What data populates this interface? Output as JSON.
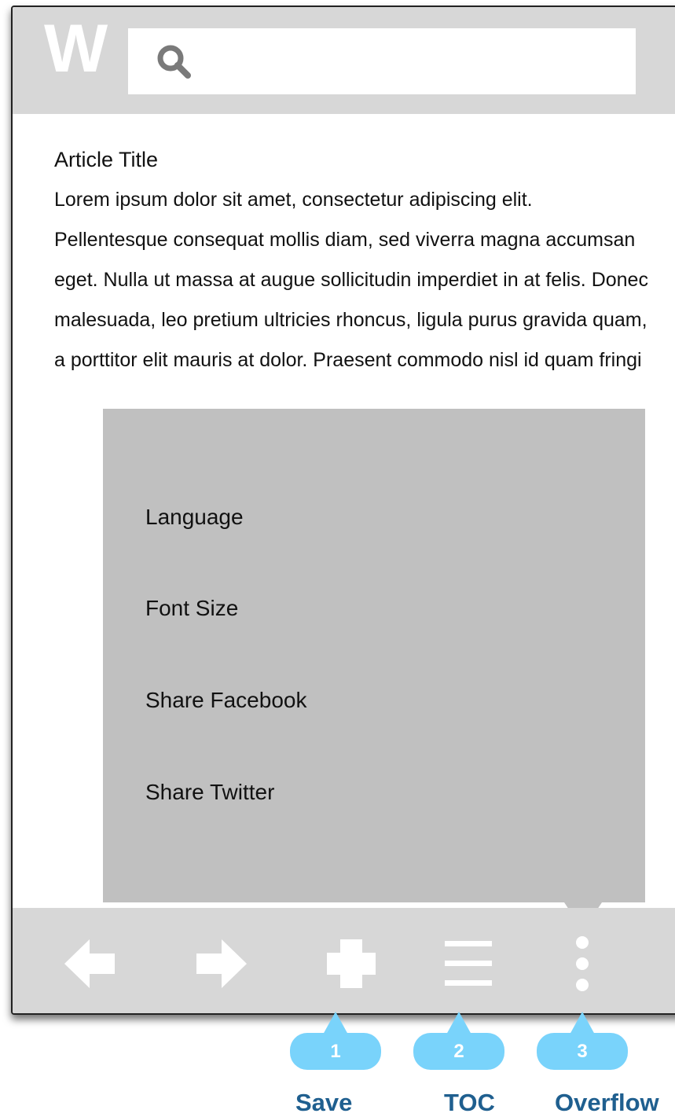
{
  "header": {
    "logo": "W"
  },
  "article": {
    "title": "Article Title",
    "body": "Lorem ipsum dolor sit amet, consectetur adipiscing elit. Pellentesque consequat mollis diam, sed viverra magna accumsan eget. Nulla ut massa at augue sollicitudin imperdiet in at felis. Donec malesuada, leo pretium ultricies rhoncus, ligula purus gravida quam, a porttitor elit mauris at dolor. Praesent commodo nisl id quam fringi"
  },
  "overflow_menu": {
    "items": [
      {
        "label": "Language"
      },
      {
        "label": "Font Size"
      },
      {
        "label": "Share Facebook"
      },
      {
        "label": "Share Twitter"
      }
    ]
  },
  "bottom_nav": {
    "icons": [
      "back-arrow-icon",
      "forward-arrow-icon",
      "plus-icon",
      "menu-lines-icon",
      "more-vertical-icon"
    ]
  },
  "callouts": [
    {
      "number": "1",
      "label": "Save"
    },
    {
      "number": "2",
      "label": "TOC"
    },
    {
      "number": "3",
      "label": "Overflow"
    }
  ],
  "colors": {
    "bar_gray": "#d7d7d7",
    "menu_gray": "#c0c0c0",
    "callout_blue": "#79d3fb",
    "callout_text": "#1f5f8f"
  }
}
